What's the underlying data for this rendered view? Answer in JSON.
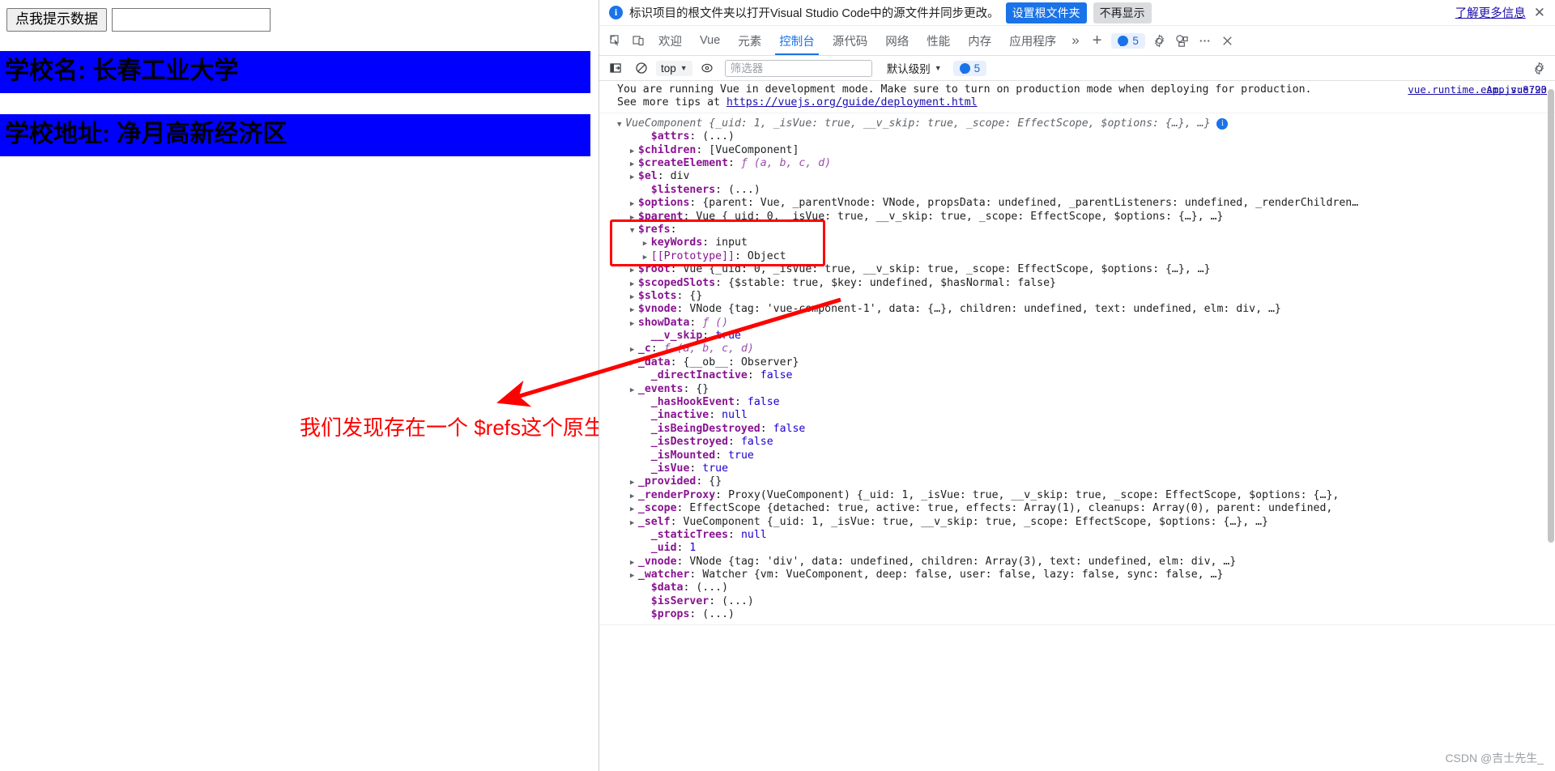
{
  "page": {
    "button_label": "点我提示数据",
    "input_value": "",
    "input_placeholder": "",
    "banners": [
      "学校名: 长春工业大学",
      "学校地址: 净月高新经济区"
    ],
    "banner_bg": "#0000ff",
    "annotation": "我们发现存在一个 $refs这个原生属性，就是负责管理ref的。",
    "annotation_color": "#ff0000"
  },
  "devtools": {
    "infobar": {
      "icon": "info-icon",
      "text": "标识项目的根文件夹以打开Visual Studio Code中的源文件并同步更改。",
      "primary_button": "设置根文件夹",
      "secondary_button": "不再显示",
      "learn_more": "了解更多信息",
      "close": "✕"
    },
    "tabs": {
      "inspect_icon": "inspect-element-icon",
      "device_icon": "device-toolbar-icon",
      "items": [
        {
          "label": "欢迎",
          "active": false
        },
        {
          "label": "Vue",
          "active": false
        },
        {
          "label": "元素",
          "active": false
        },
        {
          "label": "控制台",
          "active": true
        },
        {
          "label": "源代码",
          "active": false
        },
        {
          "label": "网络",
          "active": false
        },
        {
          "label": "性能",
          "active": false
        },
        {
          "label": "内存",
          "active": false
        },
        {
          "label": "应用程序",
          "active": false
        }
      ],
      "overflow": "»",
      "add": "+",
      "message_count": "5",
      "settings_icon": "gear-icon",
      "dock_icon": "dock-side-icon",
      "more_icon": "more-options-icon",
      "close_icon": "close-icon"
    },
    "filter_bar": {
      "sidebar_icon": "console-sidebar-icon",
      "clear_icon": "clear-console-icon",
      "context": "top",
      "eye_icon": "live-expression-icon",
      "filter_placeholder": "筛选器",
      "filter_value": "",
      "level": "默认级别",
      "issues_count": "5",
      "settings_icon": "gear-icon"
    },
    "console": {
      "vue_dev_message": {
        "line1": "You are running Vue in development mode.",
        "line2": "Make sure to turn on production mode when deploying for production.",
        "line3_prefix": "See more tips at ",
        "line3_link": "https://vuejs.org/guide/deployment.html",
        "source": "vue.runtime.esm.js:8793"
      },
      "object_message": {
        "source": "App.vue:20",
        "header": {
          "tri": "open",
          "class_name": "VueComponent",
          "preview": " {_uid: 1, _isVue: true, __v_skip: true, _scope: EffectScope, $options: {…}, …}",
          "info_badge": "i"
        },
        "rows": [
          {
            "tri": "blank",
            "indent": 2,
            "key": "$attrs",
            "sep": ": ",
            "value": "(...)",
            "vclass": "v-plain"
          },
          {
            "tri": "closed",
            "indent": 1,
            "key": "$children",
            "sep": ": ",
            "value": "[VueComponent]",
            "vclass": "v-plain"
          },
          {
            "tri": "closed",
            "indent": 1,
            "key": "$createElement",
            "sep": ": ",
            "value": "ƒ (a, b, c, d)",
            "vclass": "v-fn"
          },
          {
            "tri": "closed",
            "indent": 1,
            "key": "$el",
            "sep": ": ",
            "value": "div",
            "vclass": "v-plain"
          },
          {
            "tri": "blank",
            "indent": 2,
            "key": "$listeners",
            "sep": ": ",
            "value": "(...)",
            "vclass": "v-plain"
          },
          {
            "tri": "closed",
            "indent": 1,
            "key": "$options",
            "sep": ": ",
            "value": "{parent: Vue, _parentVnode: VNode, propsData: undefined, _parentListeners: undefined, _renderChildren…",
            "vclass": "v-plain"
          },
          {
            "tri": "closed",
            "indent": 1,
            "key": "$parent",
            "sep": ": ",
            "value": "Vue {_uid: 0, _isVue: true, __v_skip: true, _scope: EffectScope, $options: {…}, …}",
            "vclass": "v-plain"
          },
          {
            "tri": "open",
            "indent": 1,
            "key": "$refs",
            "sep": ":",
            "value": "",
            "vclass": "v-plain",
            "highlight": true
          },
          {
            "tri": "closed",
            "indent": 2,
            "key": "keyWords",
            "sep": ": ",
            "value": "input",
            "vclass": "v-plain",
            "highlight": true
          },
          {
            "tri": "closed",
            "indent": 2,
            "key": "[[Prototype]]",
            "sep": ": ",
            "value": "Object",
            "vclass": "v-plain",
            "keyclass": "kn",
            "highlight": true
          },
          {
            "tri": "closed",
            "indent": 1,
            "key": "$root",
            "sep": ": ",
            "value": "Vue {_uid: 0, _isVue: true, __v_skip: true, _scope: EffectScope, $options: {…}, …}",
            "vclass": "v-plain"
          },
          {
            "tri": "closed",
            "indent": 1,
            "key": "$scopedSlots",
            "sep": ": ",
            "value": "{$stable: true, $key: undefined, $hasNormal: false}",
            "vclass": "v-plain"
          },
          {
            "tri": "closed",
            "indent": 1,
            "key": "$slots",
            "sep": ": ",
            "value": "{}",
            "vclass": "v-plain"
          },
          {
            "tri": "closed",
            "indent": 1,
            "key": "$vnode",
            "sep": ": ",
            "value": "VNode {tag: 'vue-component-1', data: {…}, children: undefined, text: undefined, elm: div, …}",
            "vclass": "v-plain"
          },
          {
            "tri": "closed",
            "indent": 1,
            "key": "showData",
            "sep": ": ",
            "value": "ƒ ()",
            "vclass": "v-fn"
          },
          {
            "tri": "blank",
            "indent": 2,
            "key": "__v_skip",
            "sep": ": ",
            "value": "true",
            "vclass": "v-bool"
          },
          {
            "tri": "closed",
            "indent": 1,
            "key": "_c",
            "sep": ": ",
            "value": "ƒ (a, b, c, d)",
            "vclass": "v-fn"
          },
          {
            "tri": "closed",
            "indent": 1,
            "key": "_data",
            "sep": ": ",
            "value": "{__ob__: Observer}",
            "vclass": "v-plain"
          },
          {
            "tri": "blank",
            "indent": 2,
            "key": "_directInactive",
            "sep": ": ",
            "value": "false",
            "vclass": "v-bool"
          },
          {
            "tri": "closed",
            "indent": 1,
            "key": "_events",
            "sep": ": ",
            "value": "{}",
            "vclass": "v-plain"
          },
          {
            "tri": "blank",
            "indent": 2,
            "key": "_hasHookEvent",
            "sep": ": ",
            "value": "false",
            "vclass": "v-bool"
          },
          {
            "tri": "blank",
            "indent": 2,
            "key": "_inactive",
            "sep": ": ",
            "value": "null",
            "vclass": "v-bool"
          },
          {
            "tri": "blank",
            "indent": 2,
            "key": "_isBeingDestroyed",
            "sep": ": ",
            "value": "false",
            "vclass": "v-bool"
          },
          {
            "tri": "blank",
            "indent": 2,
            "key": "_isDestroyed",
            "sep": ": ",
            "value": "false",
            "vclass": "v-bool"
          },
          {
            "tri": "blank",
            "indent": 2,
            "key": "_isMounted",
            "sep": ": ",
            "value": "true",
            "vclass": "v-bool"
          },
          {
            "tri": "blank",
            "indent": 2,
            "key": "_isVue",
            "sep": ": ",
            "value": "true",
            "vclass": "v-bool"
          },
          {
            "tri": "closed",
            "indent": 1,
            "key": "_provided",
            "sep": ": ",
            "value": "{}",
            "vclass": "v-plain"
          },
          {
            "tri": "closed",
            "indent": 1,
            "key": "_renderProxy",
            "sep": ": ",
            "value": "Proxy(VueComponent) {_uid: 1, _isVue: true, __v_skip: true, _scope: EffectScope, $options: {…},",
            "vclass": "v-plain"
          },
          {
            "tri": "closed",
            "indent": 1,
            "key": "_scope",
            "sep": ": ",
            "value": "EffectScope {detached: true, active: true, effects: Array(1), cleanups: Array(0), parent: undefined, ",
            "vclass": "v-plain"
          },
          {
            "tri": "closed",
            "indent": 1,
            "key": "_self",
            "sep": ": ",
            "value": "VueComponent {_uid: 1, _isVue: true, __v_skip: true, _scope: EffectScope, $options: {…}, …}",
            "vclass": "v-plain"
          },
          {
            "tri": "blank",
            "indent": 2,
            "key": "_staticTrees",
            "sep": ": ",
            "value": "null",
            "vclass": "v-bool"
          },
          {
            "tri": "blank",
            "indent": 2,
            "key": "_uid",
            "sep": ": ",
            "value": "1",
            "vclass": "v-num"
          },
          {
            "tri": "closed",
            "indent": 1,
            "key": "_vnode",
            "sep": ": ",
            "value": "VNode {tag: 'div', data: undefined, children: Array(3), text: undefined, elm: div, …}",
            "vclass": "v-plain"
          },
          {
            "tri": "closed",
            "indent": 1,
            "key": "_watcher",
            "sep": ": ",
            "value": "Watcher {vm: VueComponent, deep: false, user: false, lazy: false, sync: false, …}",
            "vclass": "v-plain"
          },
          {
            "tri": "blank",
            "indent": 2,
            "key": "$data",
            "sep": ": ",
            "value": "(...)",
            "vclass": "v-plain"
          },
          {
            "tri": "blank",
            "indent": 2,
            "key": "$isServer",
            "sep": ": ",
            "value": "(...)",
            "vclass": "v-plain"
          },
          {
            "tri": "blank",
            "indent": 2,
            "key": "$props",
            "sep": ": ",
            "value": "(...)",
            "vclass": "v-plain"
          }
        ]
      }
    }
  },
  "watermark": "CSDN @吉士先生_"
}
